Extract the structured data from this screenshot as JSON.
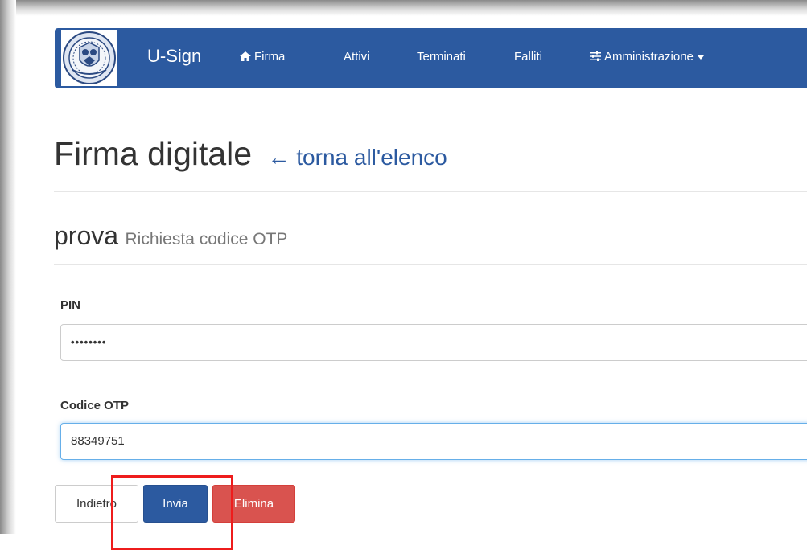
{
  "navbar": {
    "brand": "U-Sign",
    "items": [
      {
        "label": "Firma",
        "icon": "home-icon"
      },
      {
        "label": "Attivi"
      },
      {
        "label": "Terminati"
      },
      {
        "label": "Falliti"
      },
      {
        "label": "Amministrazione",
        "icon": "sliders-icon",
        "dropdown": true
      }
    ],
    "color": "#2c5aa0"
  },
  "page": {
    "title": "Firma digitale",
    "back_link": "← torna all'elenco",
    "subtitle_main": "prova",
    "subtitle_secondary": "Richiesta codice OTP"
  },
  "form": {
    "pin_label": "PIN",
    "pin_value": "••••••••",
    "otp_label": "Codice OTP",
    "otp_value": "88349751"
  },
  "buttons": {
    "back": "Indietro",
    "send": "Invia",
    "delete": "Elimina"
  }
}
